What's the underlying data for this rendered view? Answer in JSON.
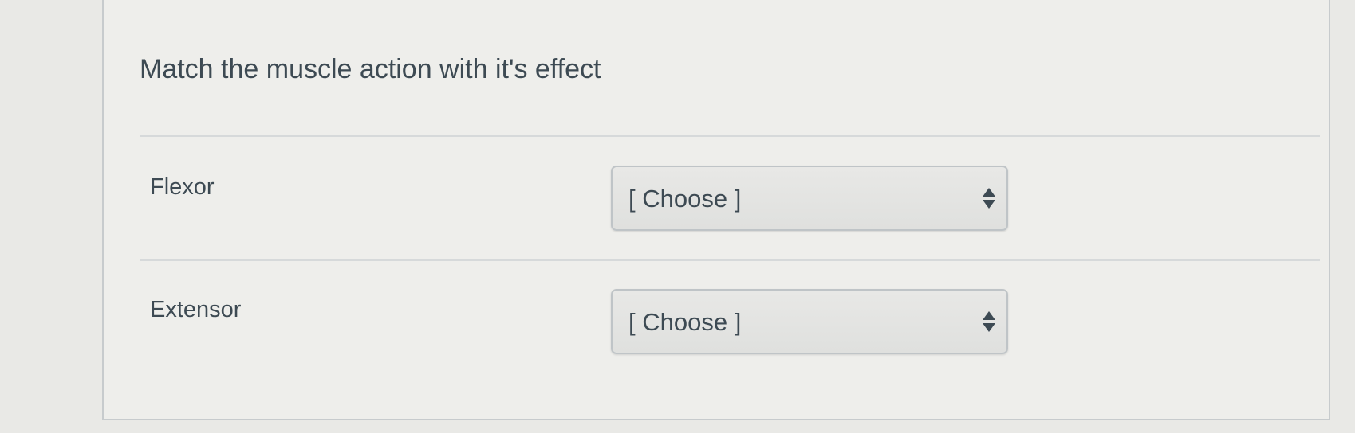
{
  "question": {
    "text": "Match the muscle action with it's effect"
  },
  "rows": [
    {
      "label": "Flexor",
      "select_value": "[ Choose ]"
    },
    {
      "label": "Extensor",
      "select_value": "[ Choose ]"
    }
  ],
  "icons": {
    "select_arrow": "up-down-chevron-icon"
  },
  "colors": {
    "text": "#3d4a53",
    "card_background": "#eeeeeb",
    "border": "#c7cbcd"
  }
}
